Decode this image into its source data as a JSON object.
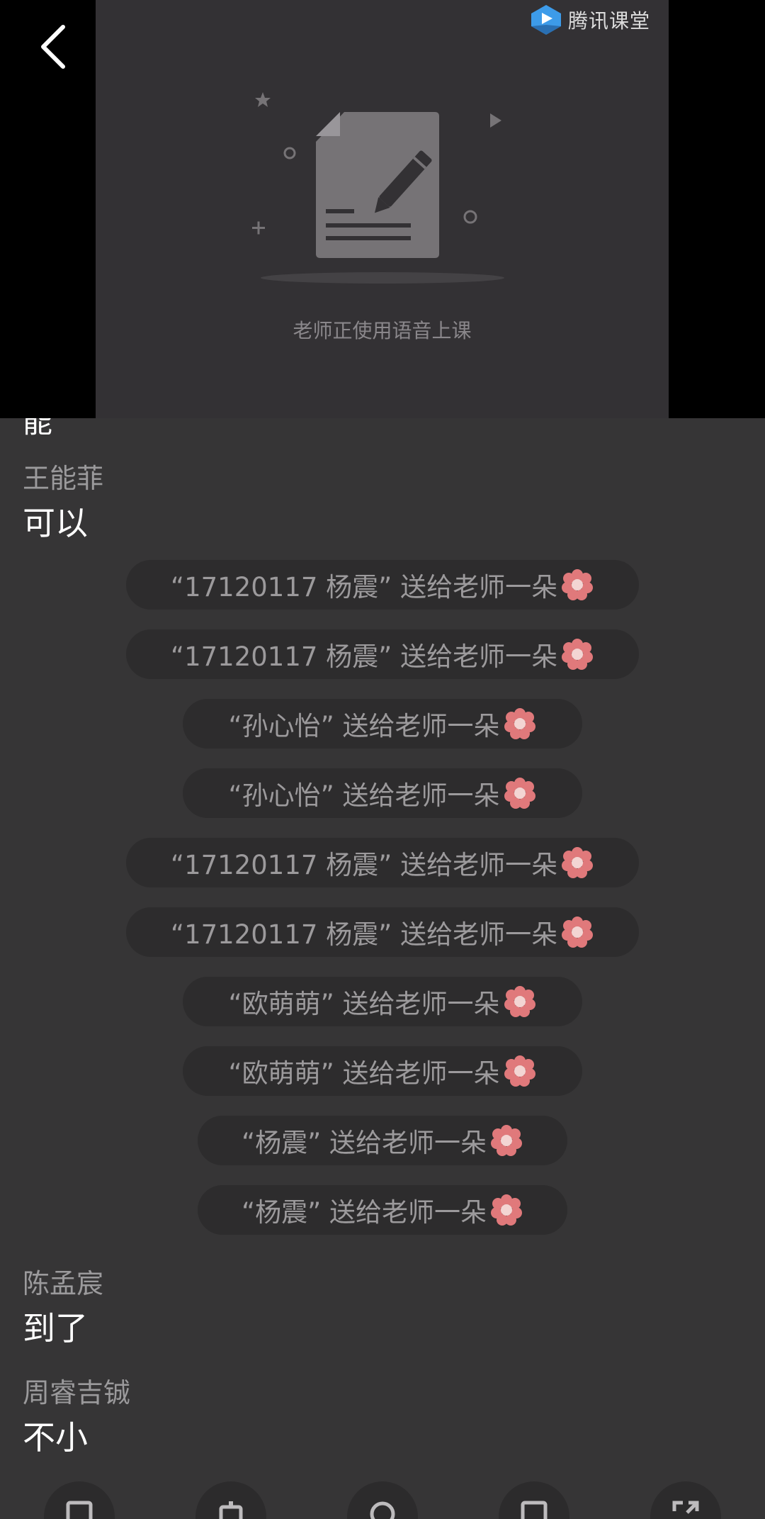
{
  "header": {
    "brand_name": "腾讯课堂",
    "voice_status": "老师正使用语音上课"
  },
  "chat": {
    "partial_text": "能",
    "messages": [
      {
        "sender": "王能菲",
        "text": "可以"
      },
      {
        "sender": "陈孟宸",
        "text": "到了"
      },
      {
        "sender": "周睿吉铖",
        "text": "不小"
      }
    ],
    "gifts": [
      "“17120117 杨震” 送给老师一朵",
      "“17120117 杨震” 送给老师一朵",
      "“孙心怡” 送给老师一朵",
      "“孙心怡” 送给老师一朵",
      "“17120117 杨震” 送给老师一朵",
      "“17120117 杨震” 送给老师一朵",
      "“欧萌萌” 送给老师一朵",
      "“欧萌萌” 送给老师一朵",
      "“杨震” 送给老师一朵",
      "“杨震” 送给老师一朵"
    ]
  },
  "icons": {
    "back": "chevron-left-icon",
    "brand": "tencent-classroom-logo",
    "gift": "flower-icon"
  },
  "colors": {
    "stage_bg": "#333134",
    "chat_bg": "#363536",
    "gift_pill_bg": "#2d2c2d",
    "flower": "#e0797b",
    "brand_blue": "#3d9be9"
  }
}
